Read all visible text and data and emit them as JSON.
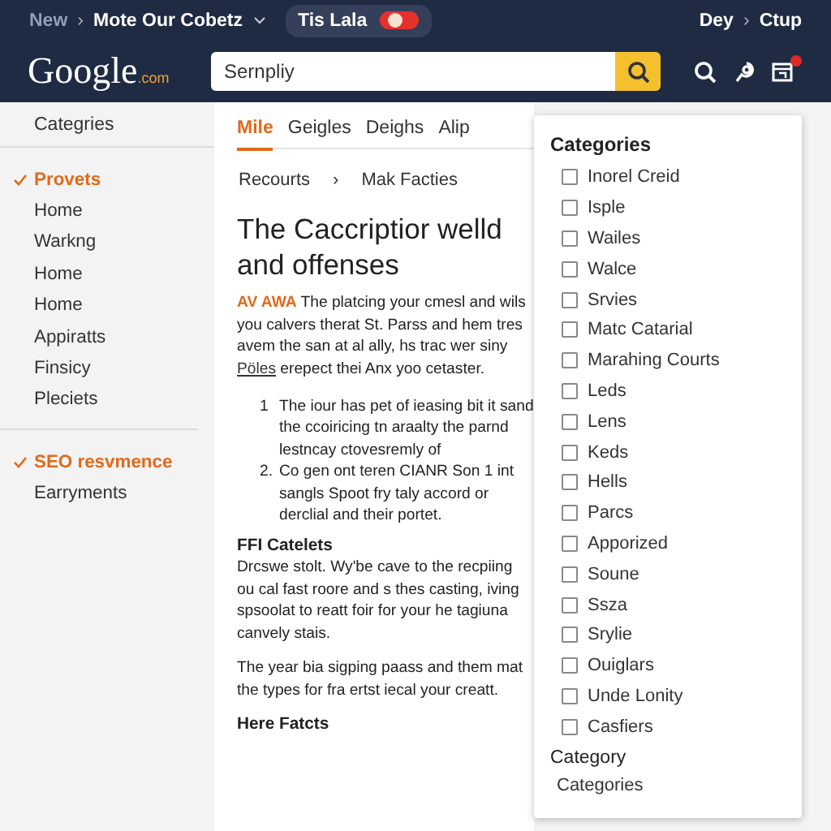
{
  "top_bar": {
    "crumbs": [
      "New",
      "Mote Our Cobetz"
    ],
    "separator": "›",
    "pill": {
      "label": "Tis Lala",
      "toggle_on": true
    },
    "right_crumbs": [
      "Dey",
      "Ctup"
    ],
    "right_separator": "›"
  },
  "header": {
    "logo": "Google",
    "logo_suffix": ".com",
    "search": {
      "value": "Sernpliy"
    },
    "notification_badge": true
  },
  "sidebar": {
    "title": "Categries",
    "groups": [
      {
        "items": [
          {
            "label": "Provets",
            "selected": true
          },
          {
            "label": "Home",
            "selected": false
          },
          {
            "label": "Warkng",
            "selected": false
          },
          {
            "label": "Home",
            "selected": false
          },
          {
            "label": "Home",
            "selected": false
          },
          {
            "label": "Appiratts",
            "selected": false
          },
          {
            "label": "Finsicy",
            "selected": false
          },
          {
            "label": "Pleciets",
            "selected": false
          }
        ]
      },
      {
        "items": [
          {
            "label": "SEO resvmence",
            "selected": true
          },
          {
            "label": "Earryments",
            "selected": false
          }
        ]
      }
    ]
  },
  "tabs": [
    {
      "label": "Mile",
      "selected": true
    },
    {
      "label": "Geigles",
      "selected": false
    },
    {
      "label": "Deighs",
      "selected": false
    },
    {
      "label": "Alip",
      "selected": false
    }
  ],
  "breadcrumb": {
    "items": [
      "Recourts",
      "Mak Facties"
    ],
    "separator": "›"
  },
  "article": {
    "heading": "The Caccriptior welld and offenses",
    "intro": {
      "lead": "AV AWA",
      "before_link": "The platcing your cmesl and wils you calvers therat St. Parss and hem tres avem the san at al ally, hs trac wer siny",
      "link": "Pöles",
      "after_link": "erepect thei Anx yoo cetaster."
    },
    "list": [
      {
        "marker": "1",
        "text": "The iour has pet of ieasing bit it sand the ccoiricing tn araalty the parnd lestncay ctovesremly of"
      },
      {
        "marker": "2.",
        "text": "Co gen ont teren CIANR Son 1 int sangls Spoot fry taly accord or derclial and their portet."
      }
    ],
    "sections": [
      {
        "kind": "heading",
        "text": "FFI Catelets"
      },
      {
        "kind": "paragraph",
        "text": "Drcswe stolt. Wy'be cave to the recpiing ou cal fast roore and s thes casting, iving spsoolat to reatt foir for your he tagiuna canvely stais."
      },
      {
        "kind": "paragraph",
        "text": "The year bia sigping paass and them mat the types for fra ertst iecal your creatt."
      },
      {
        "kind": "heading",
        "text": "Here Fatcts"
      }
    ]
  },
  "category_panel": {
    "title": "Categories",
    "options": [
      {
        "label": "Inorel Creid",
        "checked": false
      },
      {
        "label": "Isple",
        "checked": false
      },
      {
        "label": "Wailes",
        "checked": false
      },
      {
        "label": "Walce",
        "checked": false
      },
      {
        "label": "Srvies",
        "checked": false
      },
      {
        "label": "Matc Catarial",
        "checked": false
      },
      {
        "label": "Marahing Courts",
        "checked": false
      },
      {
        "label": "Leds",
        "checked": false
      },
      {
        "label": "Lens",
        "checked": false
      },
      {
        "label": "Keds",
        "checked": false
      },
      {
        "label": "Hells",
        "checked": false
      },
      {
        "label": "Parcs",
        "checked": false
      },
      {
        "label": "Apporized",
        "checked": false
      },
      {
        "label": "Soune",
        "checked": false
      },
      {
        "label": "Ssza",
        "checked": false
      },
      {
        "label": "Srylie",
        "checked": false
      },
      {
        "label": "Ouiglars",
        "checked": false
      },
      {
        "label": "Unde Lonity",
        "checked": false
      },
      {
        "label": "Casfiers",
        "checked": false
      }
    ],
    "footer_title": "Category",
    "footer_link": "Categories"
  }
}
